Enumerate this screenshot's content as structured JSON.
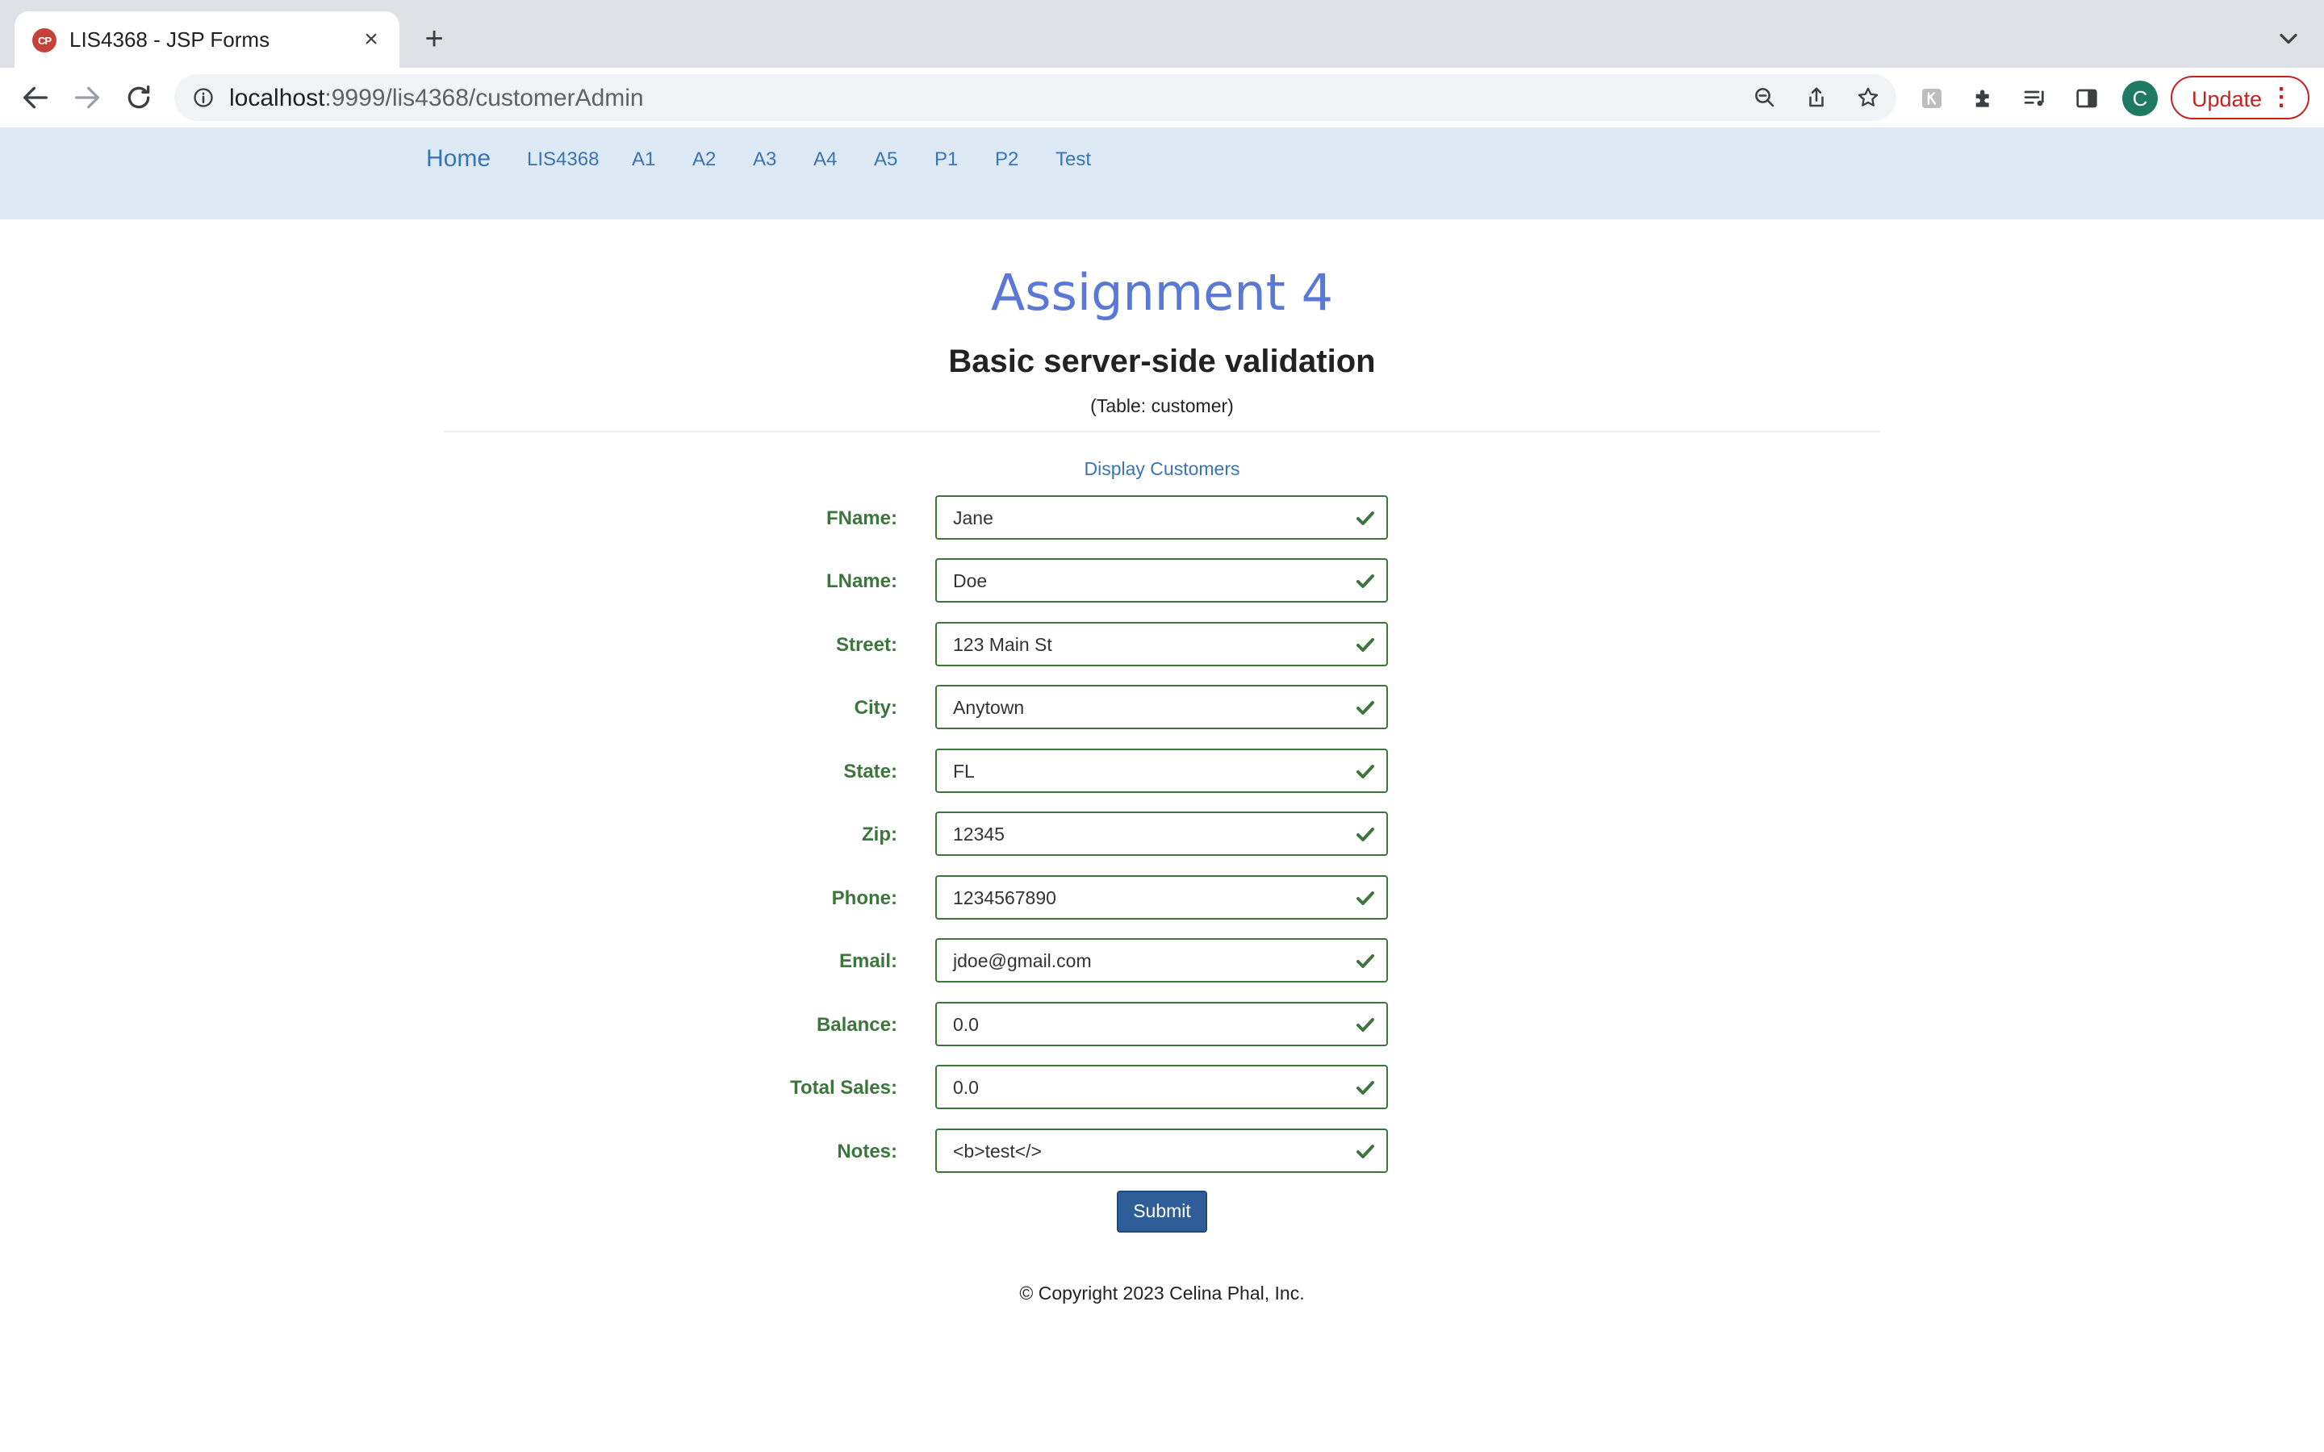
{
  "browser": {
    "tab_title": "LIS4368 - JSP Forms",
    "favicon_text": "CP",
    "url_host": "localhost",
    "url_rest": ":9999/lis4368/customerAdmin",
    "profile_initial": "C",
    "update_label": "Update"
  },
  "nav": {
    "home": "Home",
    "links": [
      "LIS4368",
      "A1",
      "A2",
      "A3",
      "A4",
      "A5",
      "P1",
      "P2",
      "Test"
    ]
  },
  "page": {
    "title": "Assignment 4",
    "subtitle": "Basic server-side validation",
    "table_note": "(Table: customer)",
    "display_link": "Display Customers",
    "submit_label": "Submit",
    "footer": "© Copyright 2023 Celina Phal, Inc."
  },
  "form": {
    "fields": [
      {
        "label": "FName:",
        "value": "Jane"
      },
      {
        "label": "LName:",
        "value": "Doe"
      },
      {
        "label": "Street:",
        "value": "123 Main St"
      },
      {
        "label": "City:",
        "value": "Anytown"
      },
      {
        "label": "State:",
        "value": "FL"
      },
      {
        "label": "Zip:",
        "value": "12345"
      },
      {
        "label": "Phone:",
        "value": "1234567890"
      },
      {
        "label": "Email:",
        "value": "jdoe@gmail.com"
      },
      {
        "label": "Balance:",
        "value": "0.0"
      },
      {
        "label": "Total Sales:",
        "value": "0.0"
      },
      {
        "label": "Notes:",
        "value": "<b>test</>"
      }
    ]
  },
  "colors": {
    "valid_green": "#3c763d",
    "navbar_bg": "#dde9f5",
    "title_blue": "#5a78d4",
    "submit_bg": "#2f5d97"
  }
}
